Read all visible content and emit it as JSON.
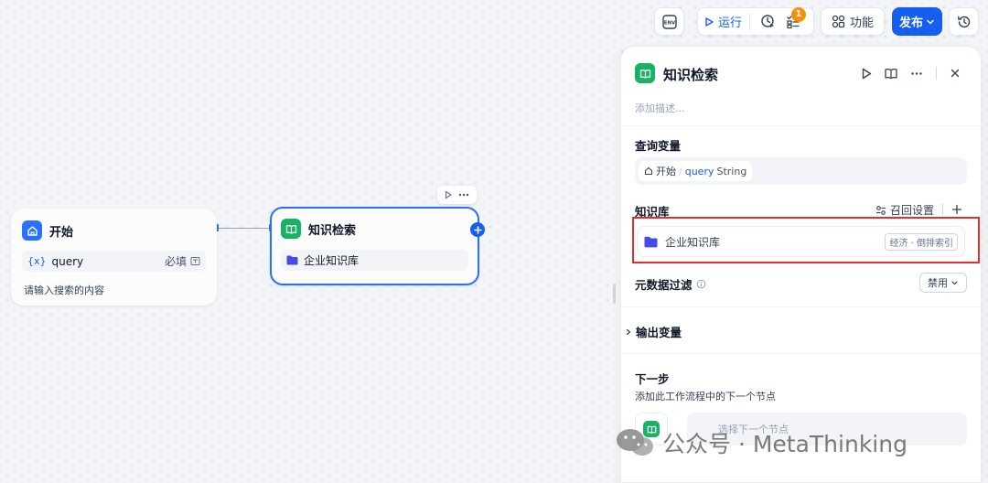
{
  "toolbar": {
    "env_label": "ENV",
    "run_label": "运行",
    "checklist_badge": "1",
    "features_label": "功能",
    "publish_label": "发布"
  },
  "canvas": {
    "start_node": {
      "title": "开始",
      "var_symbol": "{x}",
      "var_name": "query",
      "required_label": "必填",
      "description": "请输入搜索的内容"
    },
    "kr_node": {
      "title": "知识检索",
      "kb_name": "企业知识库"
    }
  },
  "panel": {
    "title": "知识检索",
    "description_placeholder": "添加描述...",
    "query_section_label": "查询变量",
    "query_source": "开始",
    "query_sep": "/",
    "query_var": "query",
    "query_type": "String",
    "kb_section_label": "知识库",
    "recall_label": "召回设置",
    "kb_item_name": "企业知识库",
    "kb_item_tag": "经济 · 倒排索引",
    "meta_filter_label": "元数据过滤",
    "meta_filter_value": "禁用",
    "output_label": "输出变量",
    "next_label": "下一步",
    "next_desc": "添加此工作流程中的下一个节点",
    "next_select_placeholder": "选择下一个节点"
  },
  "watermark": {
    "text": "公众号 · MetaThinking"
  },
  "colors": {
    "accent": "#155eef",
    "green": "#16b364",
    "highlight": "#e62e2e",
    "badge": "#f79009"
  }
}
